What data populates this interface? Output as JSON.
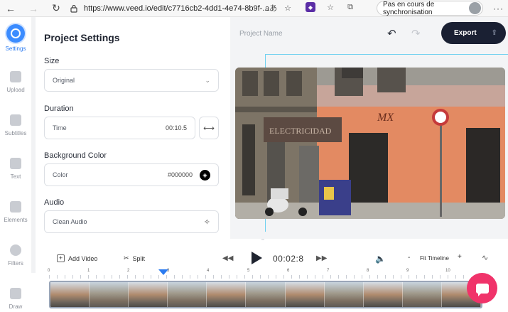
{
  "browser": {
    "url": "https://www.veed.io/edit/c7716cb2-4dd1-4e74-8b9f-...",
    "sync_label": "Pas en cours de synchronisation",
    "read_aloud_label": "aあ"
  },
  "sidebar": {
    "items": [
      {
        "label": "Settings",
        "icon": "settings-icon",
        "active": true
      },
      {
        "label": "Upload",
        "icon": "upload-icon"
      },
      {
        "label": "Subtitles",
        "icon": "subtitles-icon"
      },
      {
        "label": "Text",
        "icon": "text-icon"
      },
      {
        "label": "Elements",
        "icon": "elements-icon"
      },
      {
        "label": "Filters",
        "icon": "filters-icon"
      },
      {
        "label": "Draw",
        "icon": "draw-icon"
      }
    ]
  },
  "panel": {
    "title": "Project Settings",
    "size": {
      "label": "Size",
      "value": "Original"
    },
    "duration": {
      "label": "Duration",
      "field_label": "Time",
      "value": "00:10.5"
    },
    "background": {
      "label": "Background Color",
      "field_label": "Color",
      "value": "#000000"
    },
    "audio": {
      "label": "Audio",
      "value": "Clean Audio"
    }
  },
  "preview": {
    "project_name_placeholder": "Project Name",
    "export_label": "Export"
  },
  "timeline": {
    "add_video_label": "Add Video",
    "split_label": "Split",
    "time": "00:02:8",
    "fit_label": "Fit Timeline",
    "ticks": [
      "0",
      "1",
      "2",
      "3",
      "4",
      "5",
      "6",
      "7",
      "8",
      "9",
      "10"
    ],
    "frame_count": 11
  },
  "colors": {
    "accent": "#2b7bf0",
    "export_bg": "#1a2033",
    "chat_bg": "#f0336a"
  }
}
